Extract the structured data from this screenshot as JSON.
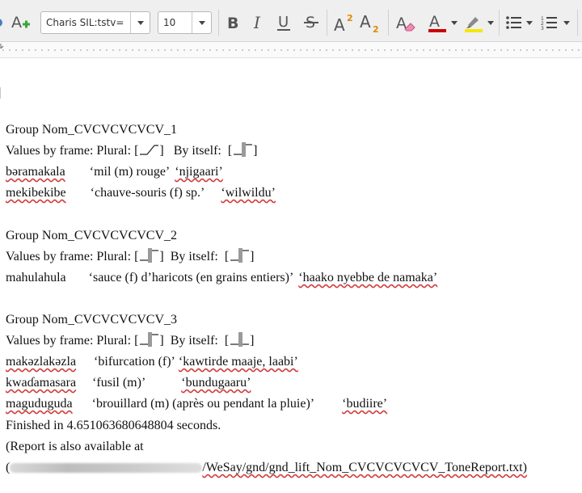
{
  "toolbar": {
    "font_name": "Charis SIL:tstv=",
    "font_size": "10",
    "colors": {
      "font_color": "#cc0000",
      "highlight_color": "#f7e600",
      "superscript_accent": "#e08a00"
    },
    "icons": [
      "styles-icon",
      "bold-icon",
      "italic-icon",
      "underline-icon",
      "strikethrough-icon",
      "superscript-icon",
      "subscript-icon",
      "clear-formatting-icon",
      "font-color-icon",
      "highlight-icon",
      "bullet-list-icon",
      "numbered-list-icon"
    ]
  },
  "document": {
    "groups": [
      {
        "title": "Group Nom_CVCVCVCVCV_1",
        "values_prefix": "Values by frame: Plural: [",
        "values_mid": "]   By itself:  [",
        "values_suffix": "]",
        "entries": [
          {
            "word": "bəramakala",
            "gloss": "‘mil (m) rouge’",
            "plural": "‘njigaari’"
          },
          {
            "word": "mekibekibe",
            "gloss": "‘chauve-souris (f) sp.’",
            "plural": "‘wilwildu’"
          }
        ]
      },
      {
        "title": "Group Nom_CVCVCVCVCV_2",
        "values_prefix": "Values by frame: Plural: [",
        "values_mid": "]  By itself:  [",
        "values_suffix": "]",
        "entries": [
          {
            "word": "mahulahula",
            "gloss": "‘sauce (f) d’haricots (en grains entiers)’",
            "plural": "‘haako nyebbe de namaka’"
          }
        ]
      },
      {
        "title": "Group Nom_CVCVCVCVCV_3",
        "values_prefix": "Values by frame: Plural: [",
        "values_mid": "]  By itself:  [",
        "values_suffix": "]",
        "entries": [
          {
            "word": "makəzlakəzla",
            "gloss": "‘bifurcation (f)’",
            "plural": "‘kawtirde maaje, laabi’"
          },
          {
            "word": "kwaɗamasara",
            "gloss": "‘fusil (m)’",
            "plural": "‘bundugaaru’"
          },
          {
            "word": "maguduguda",
            "gloss": "‘brouillard (m) (après ou pendant la pluie)’",
            "plural": "‘budiire’"
          }
        ]
      }
    ],
    "finished": "Finished in 4.651063680648804 seconds.",
    "report_line": "(Report is also available at",
    "path_open": "(",
    "path_tail": "/WeSay/gnd/gnd_lift_Nom_CVCVCVCVCV_ToneReport.txt)"
  }
}
